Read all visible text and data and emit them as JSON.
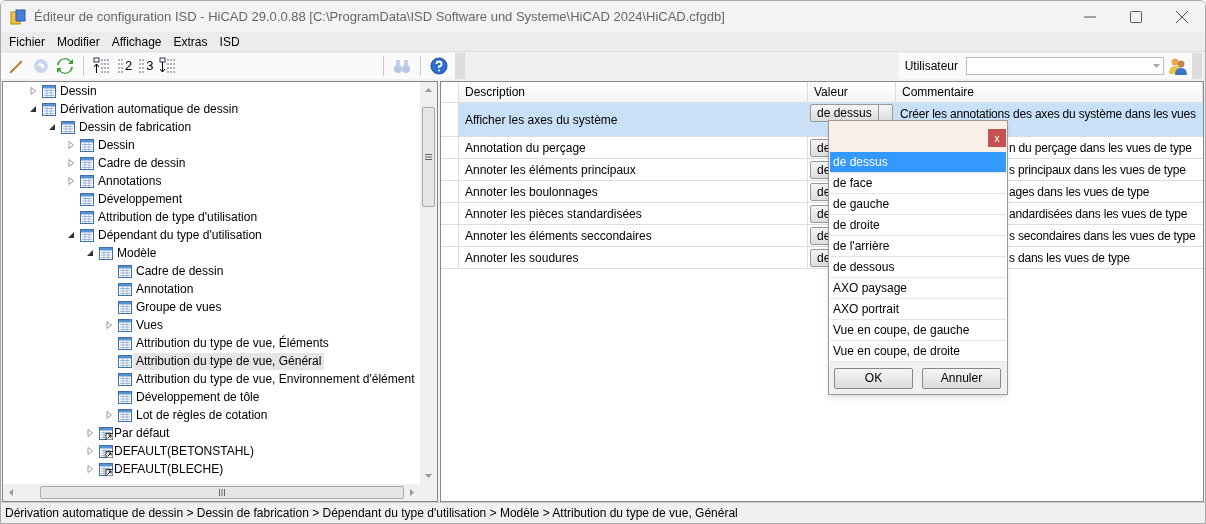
{
  "window": {
    "title": "Éditeur de configuration ISD  - HiCAD 29.0.0.88 [C:\\ProgramData\\ISD Software und Systeme\\HiCAD 2024\\HiCAD.cfgdb]"
  },
  "menu": [
    "Fichier",
    "Modifier",
    "Affichage",
    "Extras",
    "ISD"
  ],
  "toolbar": [
    {
      "kind": "edit",
      "disabled": false
    },
    {
      "kind": "undo",
      "disabled": true
    },
    {
      "kind": "refresh",
      "disabled": false
    },
    {
      "kind": "expand-up",
      "disabled": false
    },
    {
      "kind": "level",
      "label": "2",
      "disabled": false
    },
    {
      "kind": "level",
      "label": "3",
      "disabled": false
    },
    {
      "kind": "expand-down",
      "disabled": false
    },
    {
      "kind": "find",
      "disabled": true
    },
    {
      "kind": "help",
      "disabled": false
    }
  ],
  "user": {
    "label": "Utilisateur"
  },
  "tree": [
    {
      "label": "Dessin",
      "kind": "table",
      "expanded": false,
      "selected": false
    },
    {
      "label": "Dérivation automatique de dessin",
      "kind": "table",
      "expanded": true,
      "selected": false,
      "children": [
        {
          "label": "Dessin de fabrication",
          "kind": "table",
          "expanded": true,
          "selected": false,
          "children": [
            {
              "label": "Dessin",
              "kind": "table",
              "expanded": false,
              "selected": false
            },
            {
              "label": "Cadre de dessin",
              "kind": "table",
              "expanded": false,
              "selected": false
            },
            {
              "label": "Annotations",
              "kind": "table",
              "expanded": false,
              "selected": false
            },
            {
              "label": "Développement",
              "kind": "table",
              "selected": false
            },
            {
              "label": "Attribution de type d'utilisation",
              "kind": "table",
              "selected": false
            },
            {
              "label": "Dépendant du type d'utilisation",
              "kind": "table",
              "expanded": true,
              "selected": false,
              "children": [
                {
                  "label": "Modèle",
                  "kind": "table",
                  "expanded": true,
                  "selected": false,
                  "children": [
                    {
                      "label": "Cadre de dessin",
                      "kind": "table",
                      "selected": false
                    },
                    {
                      "label": "Annotation",
                      "kind": "table",
                      "selected": false
                    },
                    {
                      "label": "Groupe de vues",
                      "kind": "table",
                      "selected": false
                    },
                    {
                      "label": "Vues",
                      "kind": "table",
                      "expanded": false,
                      "selected": false
                    },
                    {
                      "label": "Attribution du type de vue, Éléments",
                      "kind": "table",
                      "selected": false
                    },
                    {
                      "label": "Attribution du type de vue, Général",
                      "kind": "table",
                      "selected": true
                    },
                    {
                      "label": "Attribution du type de vue, Environnement d'élément",
                      "kind": "table",
                      "selected": false
                    },
                    {
                      "label": "Développement de tôle",
                      "kind": "table",
                      "selected": false
                    },
                    {
                      "label": "Lot de règles de cotation",
                      "kind": "table",
                      "expanded": false,
                      "selected": false
                    }
                  ]
                },
                {
                  "label": "Par défaut",
                  "kind": "link",
                  "expanded": false,
                  "selected": false
                },
                {
                  "label": "DEFAULT(BETONSTAHL)",
                  "kind": "link",
                  "expanded": false,
                  "selected": false
                },
                {
                  "label": "DEFAULT(BLECHE)",
                  "kind": "link",
                  "expanded": false,
                  "selected": false
                }
              ]
            }
          ]
        }
      ]
    }
  ],
  "table": {
    "columns": [
      "Description",
      "Valeur",
      "Commentaire"
    ],
    "rows": [
      {
        "description": "Afficher les axes du système",
        "value": "de dessus",
        "comment": "Créer les annotations des axes du système dans les vues",
        "selected": true
      },
      {
        "description": "Annotation du perçage",
        "value": "de",
        "comment": "n du perçage dans les vues de type",
        "selected": false
      },
      {
        "description": "Annoter les éléments principaux",
        "value": "de",
        "comment": "s principaux dans les vues de type",
        "selected": false
      },
      {
        "description": "Annoter les boulonnages",
        "value": "de",
        "comment": "ages dans les vues de type",
        "selected": false
      },
      {
        "description": "Annoter les pièces standardisées",
        "value": "de",
        "comment": "andardisées dans les vues de type",
        "selected": false
      },
      {
        "description": "Annoter les éléments seccondaires",
        "value": "de",
        "comment": "s secondaires dans les vues de type",
        "selected": false
      },
      {
        "description": "Annoter les soudures",
        "value": "de",
        "comment": "s dans les vues de type",
        "selected": false
      }
    ]
  },
  "popup": {
    "close": "x",
    "options": [
      {
        "label": "de dessus",
        "selected": true
      },
      {
        "label": "de face",
        "selected": false
      },
      {
        "label": "de gauche",
        "selected": false
      },
      {
        "label": "de droite",
        "selected": false
      },
      {
        "label": "de l'arrière",
        "selected": false
      },
      {
        "label": "de dessous",
        "selected": false
      },
      {
        "label": "AXO paysage",
        "selected": false
      },
      {
        "label": "AXO portrait",
        "selected": false
      },
      {
        "label": "Vue en coupe, de gauche",
        "selected": false
      },
      {
        "label": "Vue en coupe, de droite",
        "selected": false
      }
    ],
    "buttons": [
      "OK",
      "Annuler"
    ]
  },
  "status_bar": "Dérivation automatique de dessin > Dessin de fabrication > Dépendant du type d'utilisation > Modèle > Attribution du type de vue, Général"
}
